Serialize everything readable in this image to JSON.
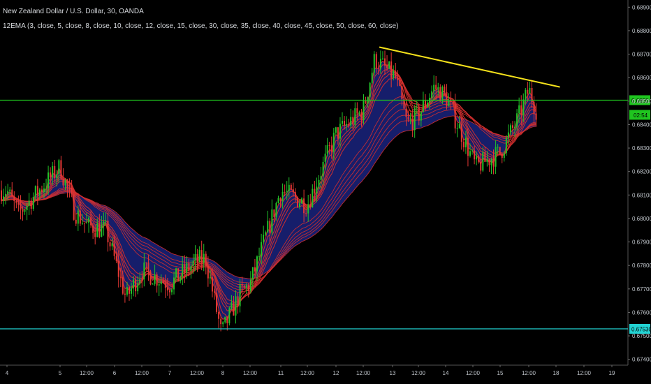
{
  "header": {
    "title": "New Zealand Dollar / U.S. Dollar, 30, OANDA",
    "indicator": "12EMA (3, close, 5, close, 8, close, 10, close, 12, close, 15, close, 30, close, 35, close, 40, close, 45, close, 50, close, 60, close)"
  },
  "colors": {
    "background": "#000000",
    "candle_up": "#22c32a",
    "candle_down": "#e53935",
    "ema_red": "#d32f2f",
    "ema_blue": "#1a237e",
    "trendline": "#f5e21b",
    "hline_green": "#1fc51f",
    "hline_cyan": "#22d3d3",
    "axis_text": "#bfc4ca"
  },
  "chart_data": {
    "type": "candlestick",
    "title": "New Zealand Dollar / U.S. Dollar, 30, OANDA",
    "ylim": [
      0.6735,
      0.6895
    ],
    "y_ticks": [
      "0.68900",
      "0.68800",
      "0.68700",
      "0.68600",
      "0.68500",
      "0.68400",
      "0.68300",
      "0.68200",
      "0.68100",
      "0.68000",
      "0.67900",
      "0.67800",
      "0.67700",
      "0.67600",
      "0.67500",
      "0.67400"
    ],
    "x_ticks": [
      "4",
      "5",
      "12:00",
      "6",
      "12:00",
      "7",
      "12:00",
      "8",
      "12:00",
      "11",
      "12:00",
      "12",
      "12:00",
      "13",
      "12:00",
      "14",
      "12:00",
      "15",
      "12:00",
      "18",
      "12:00",
      "19"
    ],
    "x_tick_ids": [
      "4",
      "5",
      "5h",
      "6",
      "6h",
      "7",
      "7h",
      "8",
      "8h",
      "11",
      "11h",
      "12",
      "12h",
      "13",
      "13h",
      "14",
      "14h",
      "15",
      "15h",
      "18",
      "18h",
      "19"
    ],
    "horizontal_lines": [
      {
        "label": "0.68504",
        "value": 0.68504,
        "color": "green"
      },
      {
        "label": "0.67530",
        "value": 0.6753,
        "color": "cyan"
      }
    ],
    "countdown": "02:54",
    "trendline": {
      "start": {
        "x_tick": "12h",
        "offset": 0.56,
        "value": 0.6873
      },
      "end": {
        "x_tick": "15h",
        "offset": 1.08,
        "value": 0.6856
      }
    },
    "price_path": [
      {
        "x": "4",
        "p": 0.6812
      },
      {
        "x": "4",
        "p": 0.6802,
        "o": 0.4
      },
      {
        "x": "5",
        "p": 0.6822,
        "o": 0
      },
      {
        "x": "5",
        "p": 0.6803,
        "o": 0.5
      },
      {
        "x": "5h",
        "p": 0.6797
      },
      {
        "x": "6",
        "p": 0.6795,
        "o": -0.3
      },
      {
        "x": "6",
        "p": 0.6766,
        "o": 0.4
      },
      {
        "x": "6h",
        "p": 0.6778
      },
      {
        "x": "7",
        "p": 0.6772
      },
      {
        "x": "7h",
        "p": 0.6782
      },
      {
        "x": "7h",
        "p": 0.6783,
        "o": 0.3
      },
      {
        "x": "8",
        "p": 0.6751,
        "o": -0.05
      },
      {
        "x": "8",
        "p": 0.6768,
        "o": 0.6
      },
      {
        "x": "8h",
        "p": 0.6772
      },
      {
        "x": "11",
        "p": 0.6812
      },
      {
        "x": "11h",
        "p": 0.6806
      },
      {
        "x": "12",
        "p": 0.6836
      },
      {
        "x": "12h",
        "p": 0.6846
      },
      {
        "x": "12h",
        "p": 0.6868,
        "o": 0.4
      },
      {
        "x": "13",
        "p": 0.686,
        "o": 0.1
      },
      {
        "x": "13",
        "p": 0.684,
        "o": 0.5
      },
      {
        "x": "13h",
        "p": 0.6844
      },
      {
        "x": "14",
        "p": 0.6856,
        "o": -0.4
      },
      {
        "x": "14",
        "p": 0.6852
      },
      {
        "x": "14h",
        "p": 0.6822,
        "o": 0.1
      },
      {
        "x": "15",
        "p": 0.6828
      },
      {
        "x": "15",
        "p": 0.6842,
        "o": 0.6
      },
      {
        "x": "15h",
        "p": 0.6855
      },
      {
        "x": "15h",
        "p": 0.6845,
        "o": 0.3
      }
    ]
  }
}
